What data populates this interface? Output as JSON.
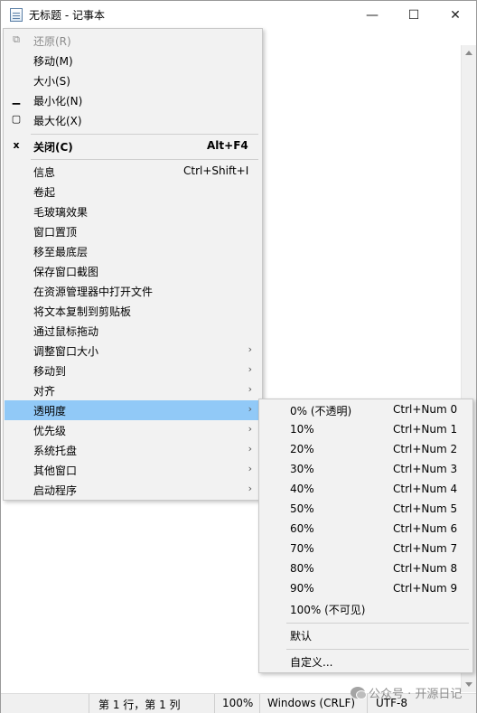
{
  "window": {
    "title": "无标题 - 记事本",
    "icon": "notepad-icon",
    "controls": {
      "minimize": "—",
      "maximize": "☐",
      "close": "✕"
    }
  },
  "system_menu": {
    "items": [
      {
        "glyph": "⧉",
        "label": "还原(R)",
        "disabled": true
      },
      {
        "glyph": "",
        "label": "移动(M)"
      },
      {
        "glyph": "",
        "label": "大小(S)"
      },
      {
        "glyph": "▁",
        "label": "最小化(N)"
      },
      {
        "glyph": "▢",
        "label": "最大化(X)"
      },
      {
        "glyph": "x",
        "label": "关闭(C)",
        "shortcut": "Alt+F4",
        "bold": true
      },
      {
        "glyph": "",
        "label": "信息",
        "shortcut": "Ctrl+Shift+I"
      },
      {
        "glyph": "",
        "label": "卷起"
      },
      {
        "glyph": "",
        "label": "毛玻璃效果"
      },
      {
        "glyph": "",
        "label": "窗口置顶"
      },
      {
        "glyph": "",
        "label": "移至最底层"
      },
      {
        "glyph": "",
        "label": "保存窗口截图"
      },
      {
        "glyph": "",
        "label": "在资源管理器中打开文件"
      },
      {
        "glyph": "",
        "label": "将文本复制到剪贴板"
      },
      {
        "glyph": "",
        "label": "通过鼠标拖动"
      },
      {
        "glyph": "",
        "label": "调整窗口大小",
        "submenu": true
      },
      {
        "glyph": "",
        "label": "移动到",
        "submenu": true
      },
      {
        "glyph": "",
        "label": "对齐",
        "submenu": true
      },
      {
        "glyph": "",
        "label": "透明度",
        "submenu": true,
        "highlighted": true
      },
      {
        "glyph": "",
        "label": "优先级",
        "submenu": true
      },
      {
        "glyph": "",
        "label": "系统托盘",
        "submenu": true
      },
      {
        "glyph": "",
        "label": "其他窗口",
        "submenu": true
      },
      {
        "glyph": "",
        "label": "启动程序",
        "submenu": true
      }
    ]
  },
  "transparency_menu": {
    "items": [
      {
        "label": "0% (不透明)",
        "shortcut": "Ctrl+Num 0"
      },
      {
        "label": "10%",
        "shortcut": "Ctrl+Num 1"
      },
      {
        "label": "20%",
        "shortcut": "Ctrl+Num 2"
      },
      {
        "label": "30%",
        "shortcut": "Ctrl+Num 3"
      },
      {
        "label": "40%",
        "shortcut": "Ctrl+Num 4"
      },
      {
        "label": "50%",
        "shortcut": "Ctrl+Num 5"
      },
      {
        "label": "60%",
        "shortcut": "Ctrl+Num 6"
      },
      {
        "label": "70%",
        "shortcut": "Ctrl+Num 7"
      },
      {
        "label": "80%",
        "shortcut": "Ctrl+Num 8"
      },
      {
        "label": "90%",
        "shortcut": "Ctrl+Num 9"
      },
      {
        "label": "100% (不可见)",
        "shortcut": ""
      },
      {
        "label": "默认",
        "shortcut": ""
      },
      {
        "label": "自定义...",
        "shortcut": ""
      }
    ]
  },
  "statusbar": {
    "position": "第 1 行，第 1 列",
    "zoom": "100%",
    "line_ending": "Windows (CRLF)",
    "encoding": "UTF-8"
  },
  "watermark": {
    "text": "公众号 · 开源日记",
    "icon": "wechat-icon"
  },
  "colors": {
    "highlight": "#91c9f7",
    "menu_bg": "#f2f2f2",
    "statusbar_bg": "#f0f0f0"
  }
}
